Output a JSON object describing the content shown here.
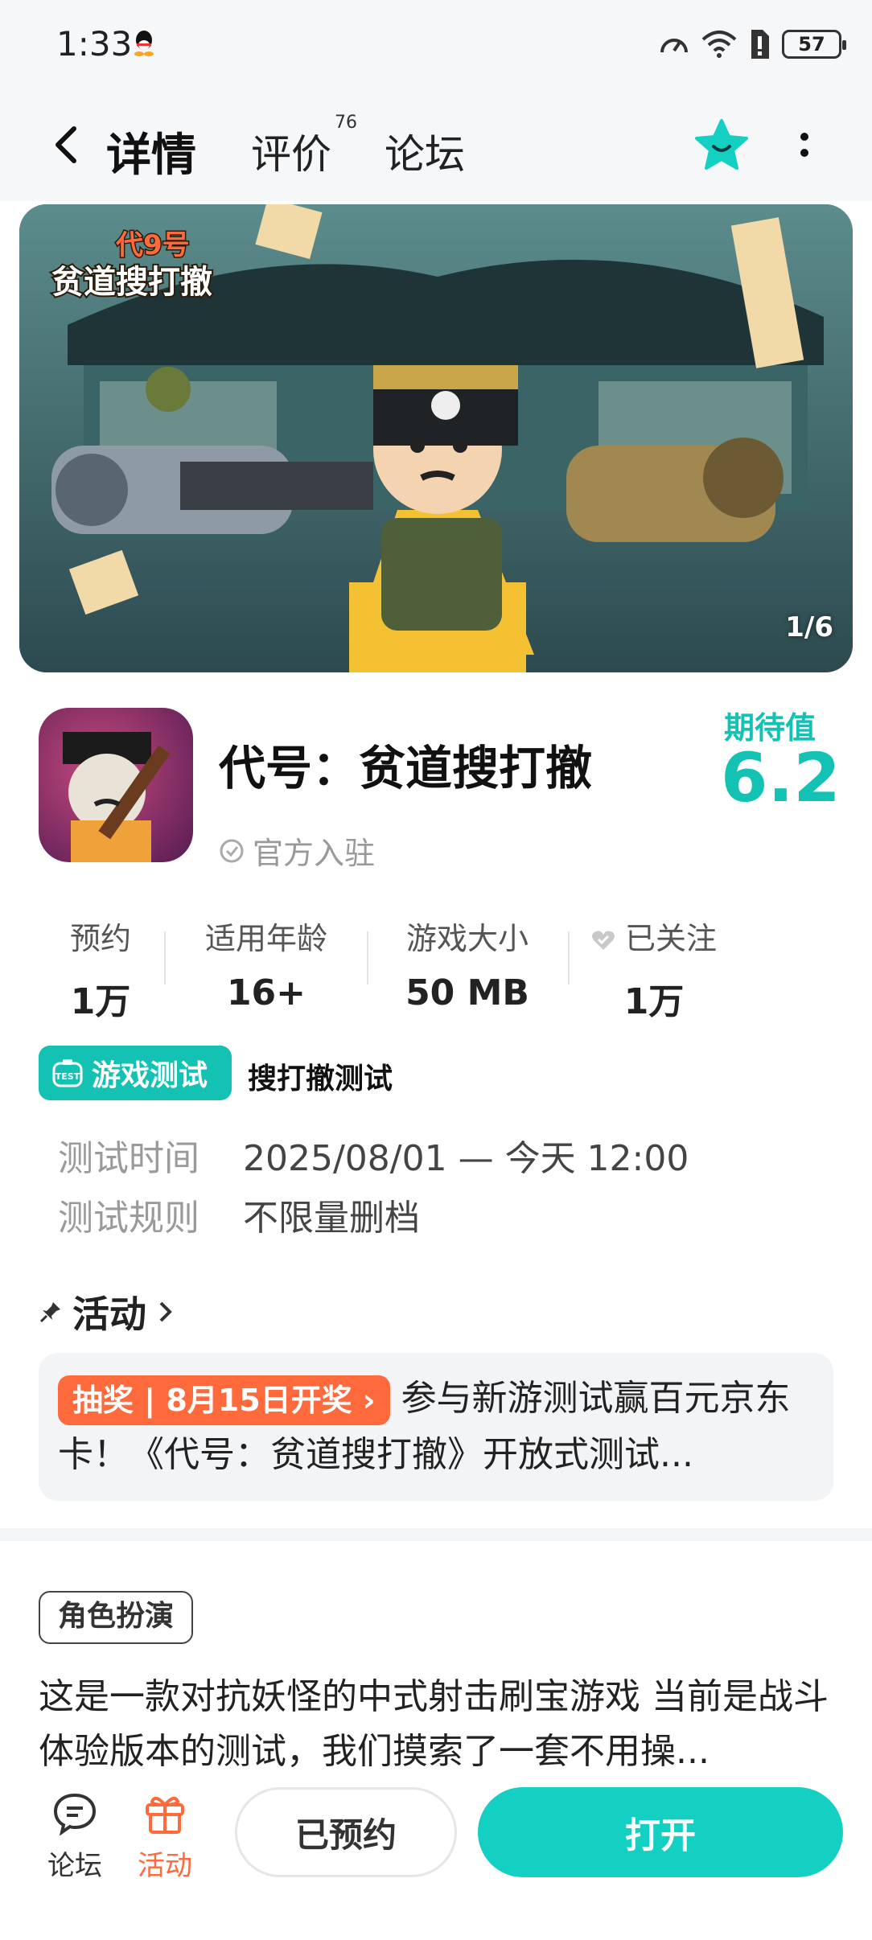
{
  "status_bar": {
    "time": "1:33",
    "battery": "57"
  },
  "nav": {
    "tabs": [
      {
        "label": "详情",
        "active": true
      },
      {
        "label": "评价",
        "count": "76"
      },
      {
        "label": "论坛"
      }
    ]
  },
  "banner": {
    "page_indicator": "1/6",
    "title_line1": "代号",
    "title_line2": "贫道搜打撤"
  },
  "app": {
    "name": "代号：贫道搜打撤",
    "official_label": "官方入驻",
    "expectation_label": "期待值",
    "expectation_value": "6.2"
  },
  "stats": [
    {
      "label": "预约",
      "value": "1万"
    },
    {
      "label": "适用年龄",
      "value": "16+"
    },
    {
      "label": "游戏大小",
      "value": "50 MB"
    },
    {
      "label": "已关注",
      "value": "1万"
    }
  ],
  "test": {
    "badge": "游戏测试",
    "name": "搜打撤测试",
    "rows": [
      {
        "key": "测试时间",
        "value": "2025/08/01 — 今天 12:00"
      },
      {
        "key": "测试规则",
        "value": "不限量删档"
      }
    ]
  },
  "activity": {
    "title": "活动",
    "tag": "抽奖 | 8月15日开奖",
    "text": "参与新游测试赢百元京东卡！《代号：贫道搜打撤》开放式测试..."
  },
  "description": {
    "genre": "角色扮演",
    "text": "这是一款对抗妖怪的中式射击刷宝游戏 当前是战斗体验版本的测试，我们摸索了一套不用操..."
  },
  "bottom": {
    "forum": "论坛",
    "activity": "活动",
    "reserved": "已预约",
    "open": "打开"
  },
  "colors": {
    "accent": "#14d0c3",
    "accent_text": "#14c2b4",
    "orange": "#ff6a3d"
  }
}
